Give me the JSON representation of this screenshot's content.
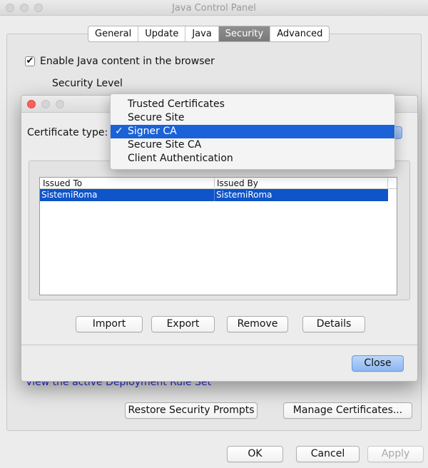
{
  "window": {
    "title": "Java Control Panel"
  },
  "tabs": [
    {
      "label": "General"
    },
    {
      "label": "Update"
    },
    {
      "label": "Java"
    },
    {
      "label": "Security"
    },
    {
      "label": "Advanced"
    }
  ],
  "security": {
    "enable_java_label": "Enable Java content in the browser",
    "enable_java_checked": "✔",
    "security_level_label": "Security Level",
    "rule_set_link": "View the active Deployment Rule Set",
    "restore_prompts_button": "Restore Security Prompts",
    "manage_certs_button": "Manage Certificates..."
  },
  "footer": {
    "ok": "OK",
    "cancel": "Cancel",
    "apply": "Apply"
  },
  "certificates_dialog": {
    "certificate_type_label": "Certificate type:",
    "dropdown_options": [
      {
        "label": "Trusted Certificates",
        "check": ""
      },
      {
        "label": "Secure Site",
        "check": ""
      },
      {
        "label": "Signer CA",
        "check": "✓"
      },
      {
        "label": "Secure Site CA",
        "check": ""
      },
      {
        "label": "Client Authentication",
        "check": ""
      }
    ],
    "table": {
      "columns": [
        "Issued To",
        "Issued By"
      ],
      "rows": [
        {
          "issued_to": "SistemiRoma",
          "issued_by": "SistemiRoma"
        }
      ]
    },
    "buttons": {
      "import": "Import",
      "export": "Export",
      "remove": "Remove",
      "details": "Details",
      "close": "Close"
    }
  },
  "colors": {
    "selection": "#0f54c8",
    "menu_highlight": "#1a62d7",
    "link": "#2a2ad8",
    "close_button": "#8cb7f0"
  }
}
